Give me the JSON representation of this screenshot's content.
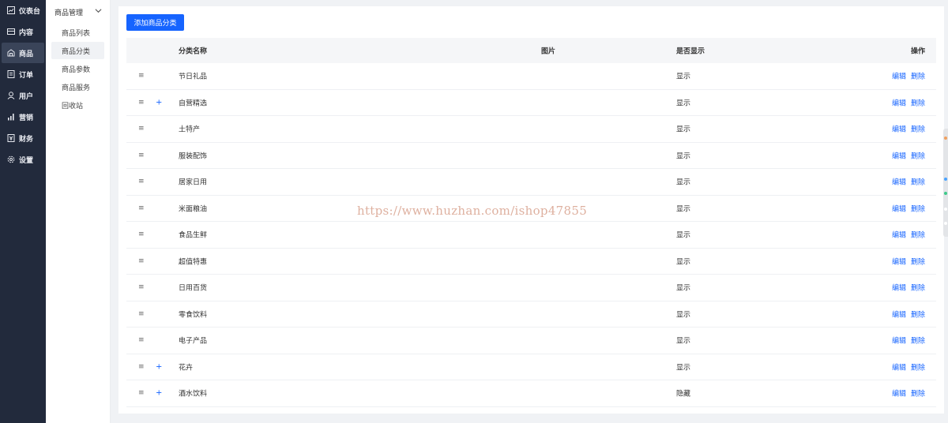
{
  "nav": {
    "items": [
      {
        "label": "仪表台",
        "icon": "dashboard-icon",
        "active": false
      },
      {
        "label": "内容",
        "icon": "content-icon",
        "active": false
      },
      {
        "label": "商品",
        "icon": "shop-icon",
        "active": true
      },
      {
        "label": "订单",
        "icon": "order-icon",
        "active": false
      },
      {
        "label": "用户",
        "icon": "user-icon",
        "active": false
      },
      {
        "label": "营销",
        "icon": "marketing-icon",
        "active": false
      },
      {
        "label": "财务",
        "icon": "finance-icon",
        "active": false
      },
      {
        "label": "设置",
        "icon": "settings-icon",
        "active": false
      }
    ]
  },
  "submenu": {
    "group_title": "商品管理",
    "items": [
      {
        "label": "商品列表",
        "active": false
      },
      {
        "label": "商品分类",
        "active": true
      },
      {
        "label": "商品参数",
        "active": false
      },
      {
        "label": "商品服务",
        "active": false
      },
      {
        "label": "回收站",
        "active": false
      }
    ]
  },
  "toolbar": {
    "add_label": "添加商品分类"
  },
  "table": {
    "headers": {
      "name": "分类名称",
      "image": "图片",
      "visible": "是否显示",
      "actions": "操作"
    },
    "edit_label": "编辑",
    "delete_label": "删除",
    "rows": [
      {
        "name": "节日礼品",
        "visible": "显示",
        "expandable": false
      },
      {
        "name": "自营精选",
        "visible": "显示",
        "expandable": true
      },
      {
        "name": "土特产",
        "visible": "显示",
        "expandable": false
      },
      {
        "name": "服装配饰",
        "visible": "显示",
        "expandable": false
      },
      {
        "name": "居家日用",
        "visible": "显示",
        "expandable": false
      },
      {
        "name": "米面粮油",
        "visible": "显示",
        "expandable": false
      },
      {
        "name": "食品生鲜",
        "visible": "显示",
        "expandable": false
      },
      {
        "name": "超值特惠",
        "visible": "显示",
        "expandable": false
      },
      {
        "name": "日用百货",
        "visible": "显示",
        "expandable": false
      },
      {
        "name": "零食饮料",
        "visible": "显示",
        "expandable": false
      },
      {
        "name": "电子产品",
        "visible": "显示",
        "expandable": false
      },
      {
        "name": "花卉",
        "visible": "显示",
        "expandable": true
      },
      {
        "name": "酒水饮料",
        "visible": "隐藏",
        "expandable": true
      }
    ]
  },
  "watermark": "https://www.huzhan.com/ishop47855",
  "colors": {
    "accent": "#1664ff",
    "sidebar_bg": "#222a3c",
    "sidebar_active": "#3a4459"
  }
}
